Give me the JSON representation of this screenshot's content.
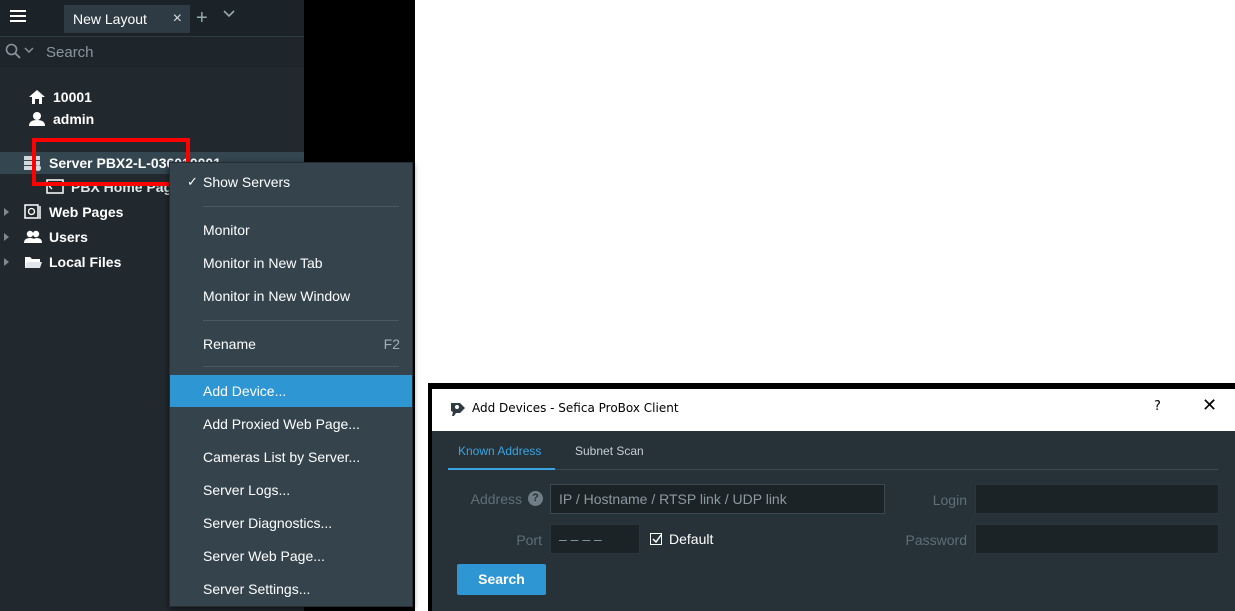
{
  "client": {
    "tab": {
      "label": "New Layout",
      "close": "×",
      "add": "+"
    },
    "search": {
      "placeholder": "Search"
    },
    "tree": {
      "system": "10001",
      "user": "admin",
      "server": "Server PBX2-L-036010001",
      "server_child": "PBX Home Page",
      "web_pages": "Web Pages",
      "users": "Users",
      "local_files": "Local Files"
    }
  },
  "context_menu": {
    "items": [
      {
        "label": "Show Servers",
        "check": "✓"
      },
      {
        "label": "Monitor"
      },
      {
        "label": "Monitor in New Tab"
      },
      {
        "label": "Monitor in New Window"
      },
      {
        "label": "Rename",
        "shortcut": "F2"
      },
      {
        "label": "Add Device...",
        "active": true
      },
      {
        "label": "Add Proxied Web Page..."
      },
      {
        "label": "Cameras List by Server..."
      },
      {
        "label": "Server Logs..."
      },
      {
        "label": "Server Diagnostics..."
      },
      {
        "label": "Server Web Page..."
      },
      {
        "label": "Server Settings..."
      }
    ]
  },
  "dialog": {
    "title": "Add Devices - Sefica ProBox Client",
    "help": "?",
    "close": "✕",
    "tabs": [
      {
        "label": "Known Address",
        "active": true
      },
      {
        "label": "Subnet Scan",
        "active": false
      }
    ],
    "address_label": "Address",
    "address_help": "?",
    "address_placeholder": "IP / Hostname / RTSP link / UDP link",
    "port_label": "Port",
    "port_placeholder": "– – – –",
    "default_label": "Default",
    "login_label": "Login",
    "password_label": "Password",
    "search_button": "Search"
  },
  "colors": {
    "accent": "#2e96d3",
    "highlight": "#ff0000",
    "panel": "#22292e",
    "menu": "#34434c"
  },
  "icons": [
    "menu-icon",
    "search-icon",
    "chevron-down-icon",
    "home-icon",
    "user-icon",
    "server-icon",
    "web-page-icon",
    "users-icon",
    "folder-icon",
    "camera-icon",
    "help-icon",
    "close-icon",
    "checkbox-icon"
  ]
}
